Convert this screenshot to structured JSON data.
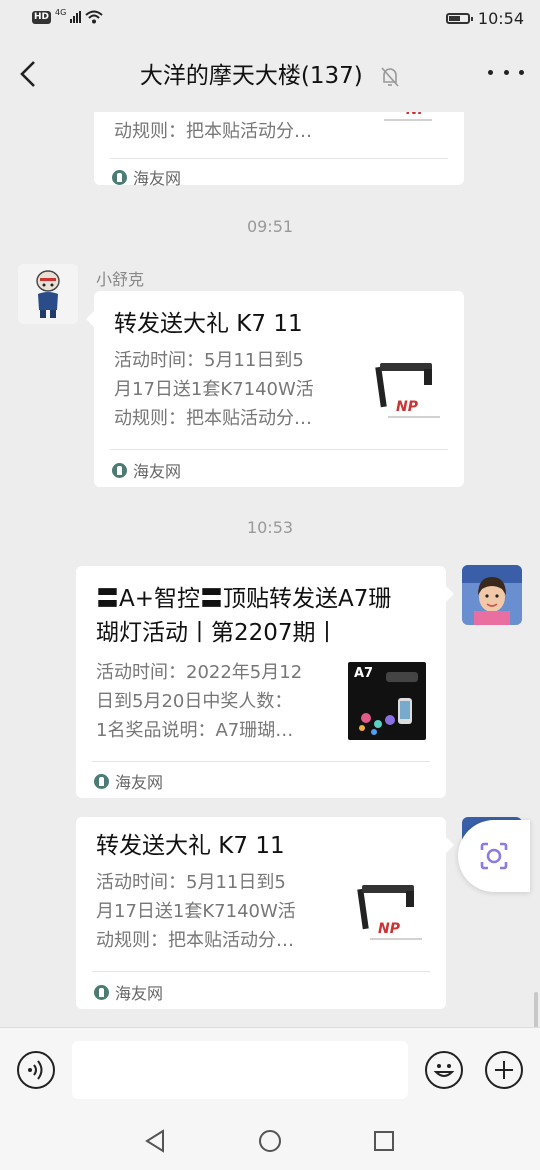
{
  "status_bar": {
    "network": "4G",
    "hd": "HD",
    "time": "10:54",
    "battery_level": 0.6
  },
  "header": {
    "title": "大洋的摩天大楼(137)",
    "muted": true
  },
  "messages": {
    "card0": {
      "desc_tail": "动规则：把本贴活动分…",
      "source": "海友网"
    },
    "ts1": "09:51",
    "sender1": "小舒克",
    "card1": {
      "title": "转发送大礼 K7 11",
      "desc_lines": [
        "活动时间：5月11日到5",
        "月17日送1套K7140W活",
        "动规则：把本贴活动分…"
      ],
      "source": "海友网"
    },
    "ts2": "10:53",
    "card2": {
      "title_lines": [
        "〓A+智控〓顶贴转发送A7珊",
        "瑚灯活动丨第2207期丨"
      ],
      "desc_lines": [
        "活动时间：2022年5月12",
        "日到5月20日中奖人数：",
        "1名奖品说明：A7珊瑚…"
      ],
      "thumb_label": "A7",
      "source": "海友网"
    },
    "card3": {
      "title": "转发送大礼 K7 11",
      "desc_lines": [
        "活动时间：5月11日到5",
        "月17日送1套K7140W活",
        "动规则：把本贴活动分…"
      ],
      "source": "海友网"
    }
  },
  "input": {
    "value": "",
    "placeholder": ""
  },
  "icons": {
    "back": "chevron-left-icon",
    "mute": "bell-off-icon",
    "more": "more-dots-icon",
    "voice": "voice-icon",
    "emoji": "emoji-icon",
    "plus": "plus-icon",
    "nav_back": "triangle-back-icon",
    "nav_home": "circle-home-icon",
    "nav_recent": "square-recent-icon"
  },
  "colors": {
    "background": "#ededed",
    "card": "#ffffff",
    "meta_text": "#999999",
    "source_icon": "#4c7b73"
  }
}
